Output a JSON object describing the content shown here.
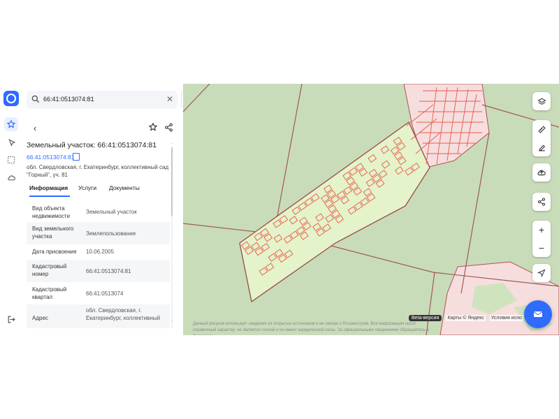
{
  "search": {
    "value": "66:41:0513074:81"
  },
  "parcel": {
    "title": "Земельный участок: 66:41:0513074:81",
    "cadastral_link": "66:41:0513074:81",
    "address": "обл. Свердловская, г. Екатеринбург, коллективный сад \"Горный\", уч. 81"
  },
  "tabs": [
    {
      "label": "Информация",
      "active": true
    },
    {
      "label": "Услуги",
      "active": false
    },
    {
      "label": "Документы",
      "active": false
    }
  ],
  "info_rows": [
    {
      "key": "Вид объекта недвижимости",
      "value": "Земельный участок"
    },
    {
      "key": "Вид земельного участка",
      "value": "Землепользование"
    },
    {
      "key": "Дата присвоения",
      "value": "10.06.2005"
    },
    {
      "key": "Кадастровый номер",
      "value": "66:41:0513074:81"
    },
    {
      "key": "Кадастровый квартал",
      "value": "66:41:0513074"
    },
    {
      "key": "Адрес",
      "value": "обл. Свердловская, г. Екатеринбург, коллективный"
    }
  ],
  "map": {
    "attribution": {
      "beta": "Beta-версия",
      "maps": "Карты © Яндекс",
      "terms": "Условия испо"
    },
    "disclaimer": "Данный рисунок использует сведения из открытых источников и не связан с Росреестром. Вся информация носит справочный характер, не является точной и не имеет юридической силы. За официальными сведениями обращайтесь в Росреестр."
  },
  "colors": {
    "accent": "#2f6bff",
    "forest": "#c9dcba",
    "parcel_fill": "#e4f3c9",
    "parcel_border": "#9c4a4a",
    "lot_stroke": "#e8594e",
    "urban": "#f6dede"
  },
  "icons": [
    "search-icon",
    "close-icon",
    "back-icon",
    "star-icon",
    "share-icon",
    "copy-icon",
    "layers-icon",
    "ruler-icon",
    "edit-icon",
    "upload-icon",
    "plus-icon",
    "minus-icon",
    "locate-icon",
    "mail-icon",
    "logout-icon",
    "cloud-icon",
    "select-icon",
    "pin-icon"
  ]
}
